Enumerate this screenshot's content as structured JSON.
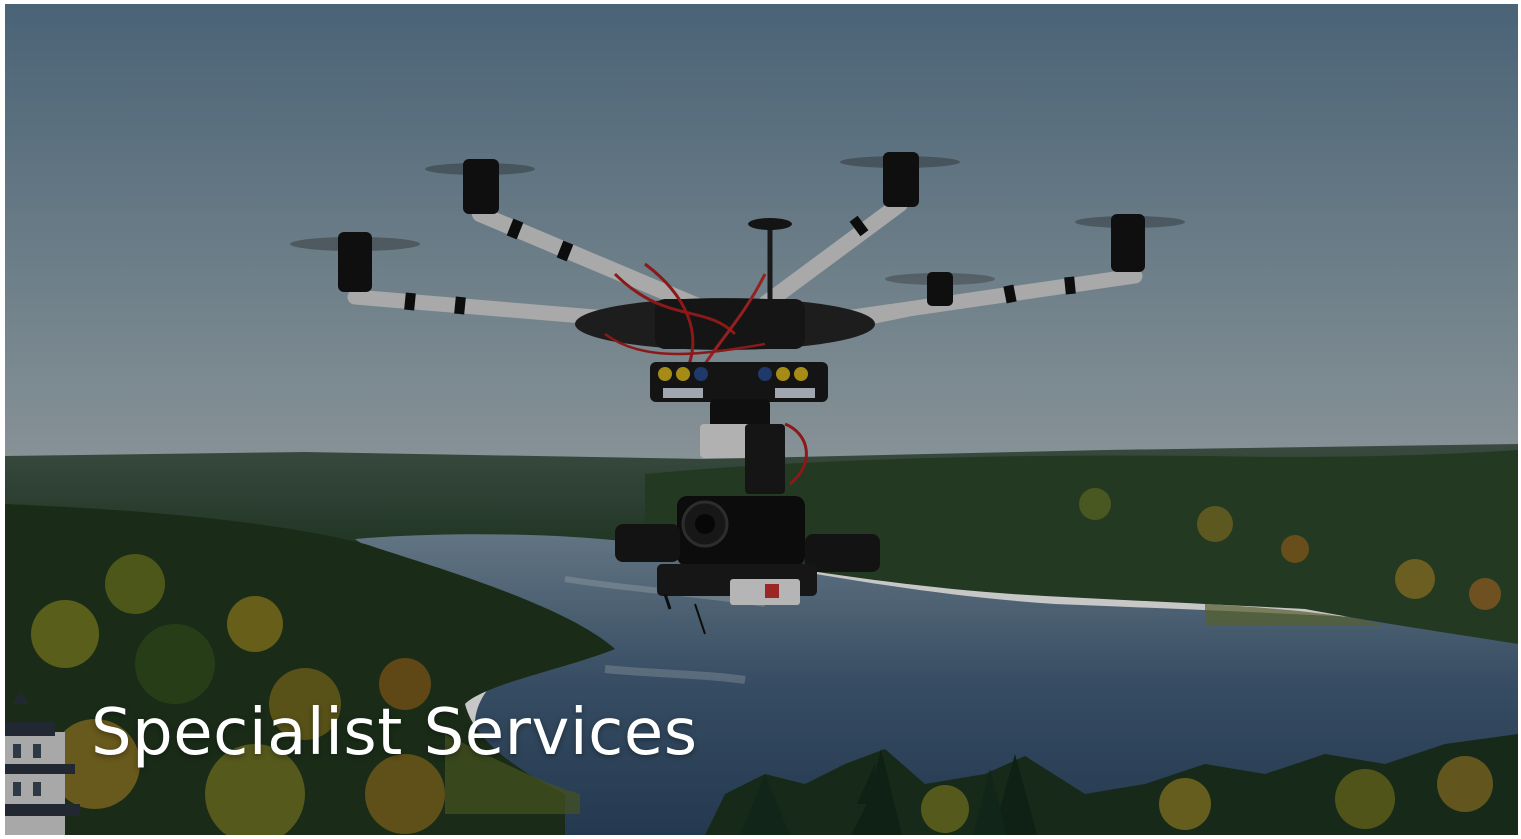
{
  "hero": {
    "title": "Specialist Services",
    "image": {
      "subject": "drone-icon",
      "colors": {
        "sky_top": "#5f7f98",
        "sky_horizon": "#a9b8bf",
        "forest_dark": "#1f3a22",
        "forest_autumn": "#b38a2a",
        "lake": "#3c5b78",
        "drone_body": "#151515",
        "drone_arm": "#d9d9d9",
        "wires_red": "#b22020",
        "battery_yellow": "#d6b21e"
      }
    },
    "overlay_color": "#000000"
  }
}
